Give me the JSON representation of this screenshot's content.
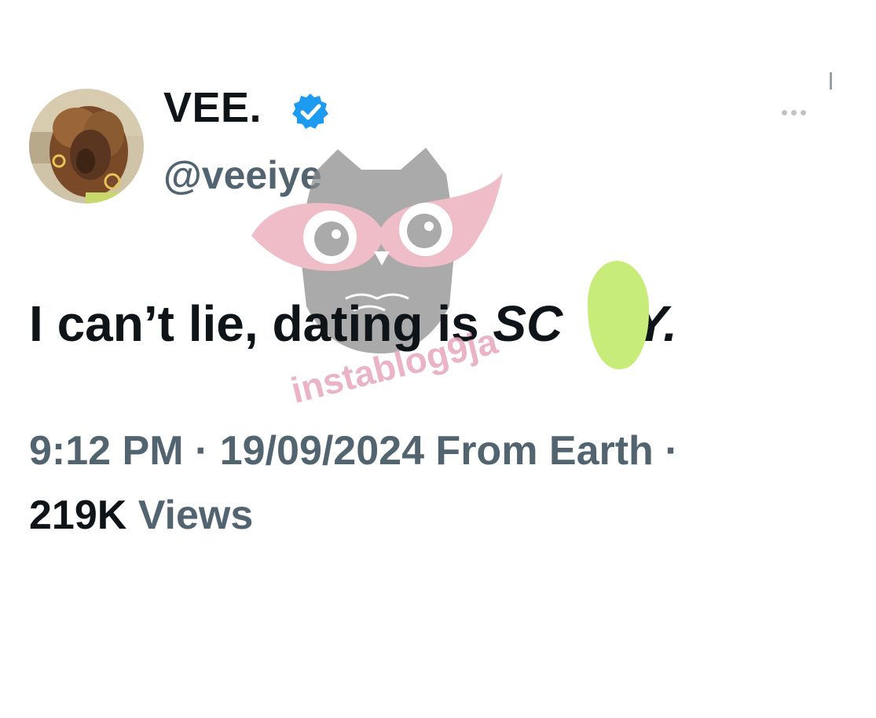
{
  "author": {
    "display_name": "VEE.",
    "handle": "@veeiye",
    "verified_icon": "verified-badge-icon",
    "avatar_icon": "avatar-photo"
  },
  "tweet": {
    "text_before": "I can’t lie, dating is ",
    "text_italic_start": "SC",
    "text_italic_end": "RY",
    "text_after": "."
  },
  "meta": {
    "timestamp_line": "9:12 PM · 19/09/2024 From Earth ·",
    "views_count": "219K",
    "views_label": "Views"
  },
  "watermark": {
    "text": "instablog9ja"
  },
  "colors": {
    "text_primary": "#0f1419",
    "text_secondary": "#536471",
    "verified_blue": "#1d9bf0",
    "censor_green": "#c8ec7a",
    "watermark_pink": "#e7a6bd"
  }
}
